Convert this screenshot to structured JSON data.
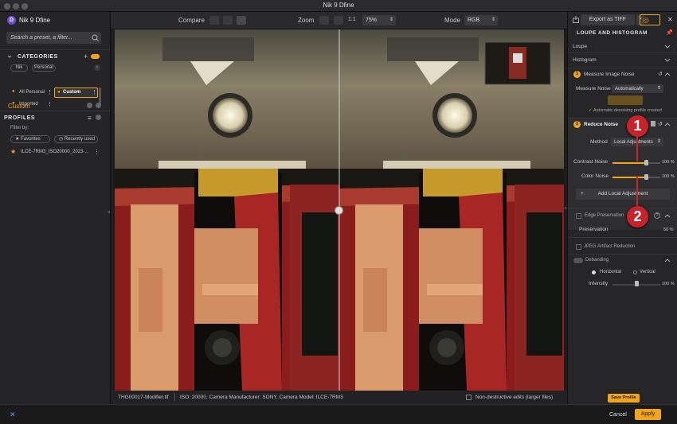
{
  "window": {
    "title": "Nik 9 Dfine"
  },
  "sidebar": {
    "app_name": "Nik 9 Dfine",
    "search_placeholder": "Search a preset, a filter...",
    "categories_label": "CATEGORIES",
    "source_tabs": [
      "Nik",
      "Personal"
    ],
    "category_items": [
      {
        "label": "All Personal"
      },
      {
        "label": "Custom"
      },
      {
        "label": "Imported"
      }
    ],
    "selected_category": "Custom",
    "profiles_label": "PROFILES",
    "filter_by": "Filter by:",
    "filters": [
      "Favorites",
      "Recently used"
    ],
    "profile_items": [
      {
        "label": "ILCE-7RM3_ISO20000_2023-..."
      }
    ]
  },
  "toolbar": {
    "compare_label": "Compare",
    "zoom_label": "Zoom",
    "zoom_ratio": "1:1",
    "zoom_value": "75%",
    "mode_label": "Mode",
    "mode_value": "RGB"
  },
  "status": {
    "filename": "THG00017-Modifier.tif",
    "meta": "ISO: 20000, Camera Manufacturer: SONY, Camera Model: ILCE-7RM3",
    "nondestructive": "Non-destructive edits (larger files)"
  },
  "right_panel": {
    "export_label": "Export as TIFF",
    "section_title": "LOUPE AND HISTOGRAM",
    "loupe": "Loupe",
    "histogram": "Histogram",
    "step1_title": "Measure Image Noise",
    "measure_label": "Measure Noise",
    "measure_value": "Automatically",
    "profile_note": "Automatic denoising profile created",
    "step2_title": "Reduce Noise",
    "method_label": "Method",
    "method_value": "Local Adjustments",
    "contrast_label": "Contrast Noise",
    "contrast_value": "100 %",
    "contrast_level": 1.0,
    "color_label": "Color Noise",
    "color_value": "100 %",
    "color_level": 1.0,
    "add_local": "Add Local Adjustment",
    "edge_label": "Edge Preservation",
    "preservation_label": "Preservation",
    "preservation_value": "50 %",
    "jpeg_label": "JPEG Artifact Reduction",
    "debanding_label": "Debanding",
    "horizontal": "Horizontal",
    "vertical": "Vertical",
    "intensity_label": "Intensity",
    "intensity_value": "100 %",
    "save_profile": "Save Profile",
    "annotations": [
      "1",
      "2"
    ]
  },
  "footer": {
    "cancel": "Cancel",
    "apply": "Apply"
  },
  "colors": {
    "accent": "#f2a41b",
    "annotation": "#c8232c"
  }
}
